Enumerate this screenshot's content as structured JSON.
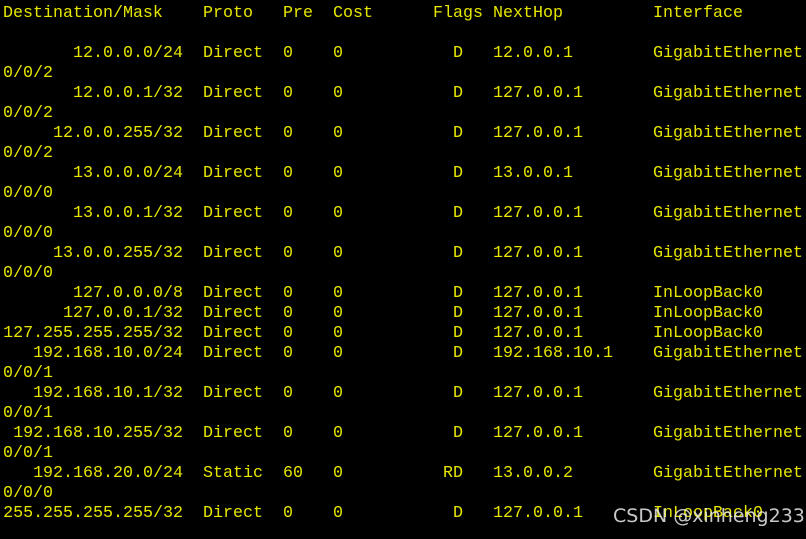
{
  "terminal": {
    "text_color": "#e6e600",
    "background": "#000000",
    "headers": {
      "destination": "Destination/Mask",
      "proto": "Proto",
      "pre": "Pre",
      "cost": "Cost",
      "flags": "Flags",
      "nexthop": "NextHop",
      "interface": "Interface"
    },
    "routes": [
      {
        "destination": "12.0.0.0/24",
        "proto": "Direct",
        "pre": "0",
        "cost": "0",
        "flags": "D",
        "nexthop": "12.0.0.1",
        "interface": "GigabitEthernet",
        "interface_wrap": "0/0/2"
      },
      {
        "destination": "12.0.0.1/32",
        "proto": "Direct",
        "pre": "0",
        "cost": "0",
        "flags": "D",
        "nexthop": "127.0.0.1",
        "interface": "GigabitEthernet",
        "interface_wrap": "0/0/2"
      },
      {
        "destination": "12.0.0.255/32",
        "proto": "Direct",
        "pre": "0",
        "cost": "0",
        "flags": "D",
        "nexthop": "127.0.0.1",
        "interface": "GigabitEthernet",
        "interface_wrap": "0/0/2"
      },
      {
        "destination": "13.0.0.0/24",
        "proto": "Direct",
        "pre": "0",
        "cost": "0",
        "flags": "D",
        "nexthop": "13.0.0.1",
        "interface": "GigabitEthernet",
        "interface_wrap": "0/0/0"
      },
      {
        "destination": "13.0.0.1/32",
        "proto": "Direct",
        "pre": "0",
        "cost": "0",
        "flags": "D",
        "nexthop": "127.0.0.1",
        "interface": "GigabitEthernet",
        "interface_wrap": "0/0/0"
      },
      {
        "destination": "13.0.0.255/32",
        "proto": "Direct",
        "pre": "0",
        "cost": "0",
        "flags": "D",
        "nexthop": "127.0.0.1",
        "interface": "GigabitEthernet",
        "interface_wrap": "0/0/0"
      },
      {
        "destination": "127.0.0.0/8",
        "proto": "Direct",
        "pre": "0",
        "cost": "0",
        "flags": "D",
        "nexthop": "127.0.0.1",
        "interface": "InLoopBack0"
      },
      {
        "destination": "127.0.0.1/32",
        "proto": "Direct",
        "pre": "0",
        "cost": "0",
        "flags": "D",
        "nexthop": "127.0.0.1",
        "interface": "InLoopBack0"
      },
      {
        "destination": "127.255.255.255/32",
        "proto": "Direct",
        "pre": "0",
        "cost": "0",
        "flags": "D",
        "nexthop": "127.0.0.1",
        "interface": "InLoopBack0"
      },
      {
        "destination": "192.168.10.0/24",
        "proto": "Direct",
        "pre": "0",
        "cost": "0",
        "flags": "D",
        "nexthop": "192.168.10.1",
        "interface": "GigabitEthernet",
        "interface_wrap": "0/0/1"
      },
      {
        "destination": "192.168.10.1/32",
        "proto": "Direct",
        "pre": "0",
        "cost": "0",
        "flags": "D",
        "nexthop": "127.0.0.1",
        "interface": "GigabitEthernet",
        "interface_wrap": "0/0/1"
      },
      {
        "destination": "192.168.10.255/32",
        "proto": "Direct",
        "pre": "0",
        "cost": "0",
        "flags": "D",
        "nexthop": "127.0.0.1",
        "interface": "GigabitEthernet",
        "interface_wrap": "0/0/1"
      },
      {
        "destination": "192.168.20.0/24",
        "proto": "Static",
        "pre": "60",
        "cost": "0",
        "flags": "RD",
        "nexthop": "13.0.0.2",
        "interface": "GigabitEthernet",
        "interface_wrap": "0/0/0"
      },
      {
        "destination": "255.255.255.255/32",
        "proto": "Direct",
        "pre": "0",
        "cost": "0",
        "flags": "D",
        "nexthop": "127.0.0.1",
        "interface": "InLoopBack0"
      }
    ]
  },
  "watermark": "CSDN @xinheng233"
}
